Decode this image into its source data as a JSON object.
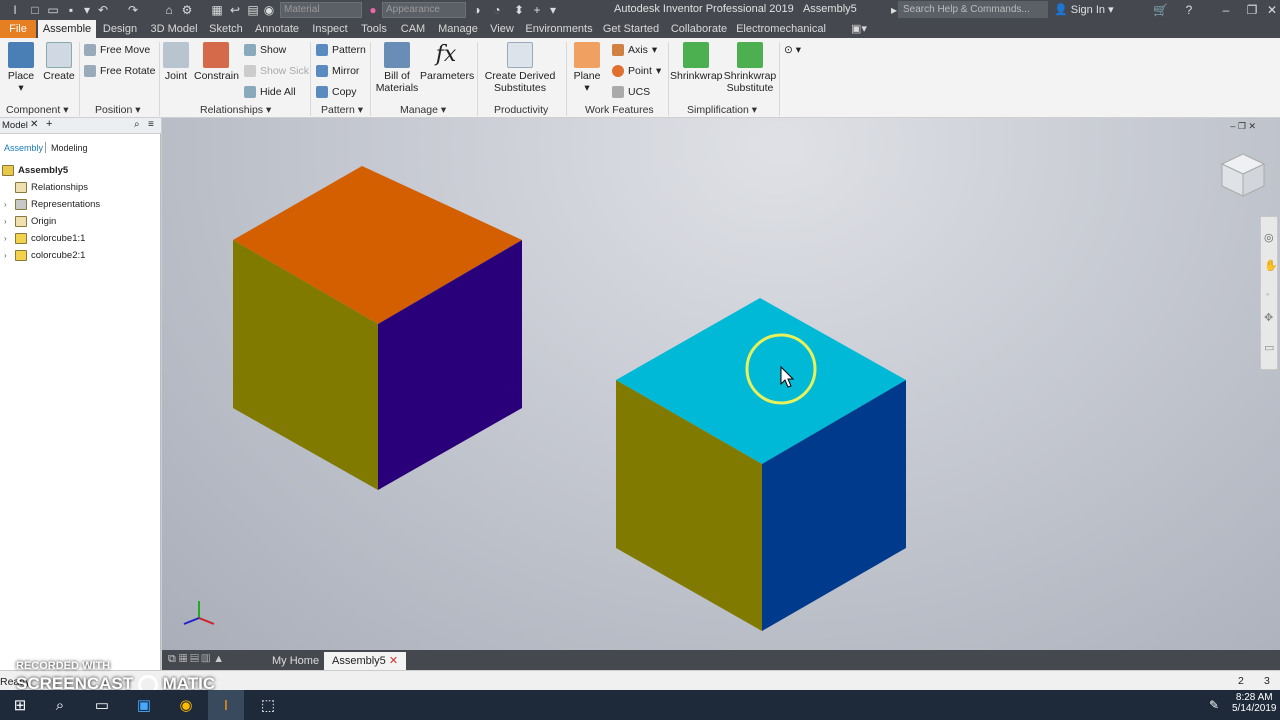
{
  "window": {
    "title": "Autodesk Inventor Professional 2019",
    "document": "Assembly5",
    "material_placeholder": "Material",
    "appearance_placeholder": "Appearance",
    "search_placeholder": "Search Help & Commands...",
    "sign_in": "Sign In"
  },
  "tabs": [
    "File",
    "Assemble",
    "Design",
    "3D Model",
    "Sketch",
    "Annotate",
    "Inspect",
    "Tools",
    "CAM",
    "Manage",
    "View",
    "Environments",
    "Get Started",
    "Collaborate",
    "Electromechanical"
  ],
  "ribbon": {
    "place": "Place",
    "create": "Create",
    "free_move": "Free Move",
    "free_rotate": "Free Rotate",
    "joint": "Joint",
    "constrain": "Constrain",
    "show": "Show",
    "show_sick": "Show Sick",
    "hide_all": "Hide All",
    "pattern": "Pattern",
    "mirror": "Mirror",
    "copy": "Copy",
    "bom_1": "Bill of",
    "bom_2": "Materials",
    "parameters": "Parameters",
    "derived_1": "Create Derived",
    "derived_2": "Substitutes",
    "plane": "Plane",
    "axis": "Axis",
    "point": "Point",
    "ucs": "UCS",
    "shrinkwrap": "Shrinkwrap",
    "shrinkwrap_sub_1": "Shrinkwrap",
    "shrinkwrap_sub_2": "Substitute",
    "panels": {
      "component": "Component",
      "position": "Position",
      "relationships": "Relationships",
      "pattern": "Pattern",
      "manage": "Manage",
      "productivity": "Productivity",
      "work_features": "Work Features",
      "simplification": "Simplification"
    }
  },
  "browser": {
    "title": "Model",
    "tab_assembly": "Assembly",
    "tab_modeling": "Modeling",
    "root": "Assembly5",
    "items": [
      "Relationships",
      "Representations",
      "Origin",
      "colorcube1:1",
      "colorcube2:1"
    ]
  },
  "doc_tabs": {
    "home": "My Home",
    "assembly": "Assembly5"
  },
  "status": {
    "text": "Ready",
    "count_a": "2",
    "count_b": "3"
  },
  "watermark": {
    "line1": "RECORDED WITH",
    "line2": "SCREENCAST",
    "line3": "MATIC"
  },
  "taskbar": {
    "time": "8:28 AM",
    "date": "5/14/2019"
  },
  "colors": {
    "cube1_top": "#d35f00",
    "cube1_left": "#807a00",
    "cube1_right": "#2a007a",
    "cube2_top": "#00b9d6",
    "cube2_left": "#807a00",
    "cube2_right": "#003a8c",
    "file_tab": "#e67e22"
  }
}
